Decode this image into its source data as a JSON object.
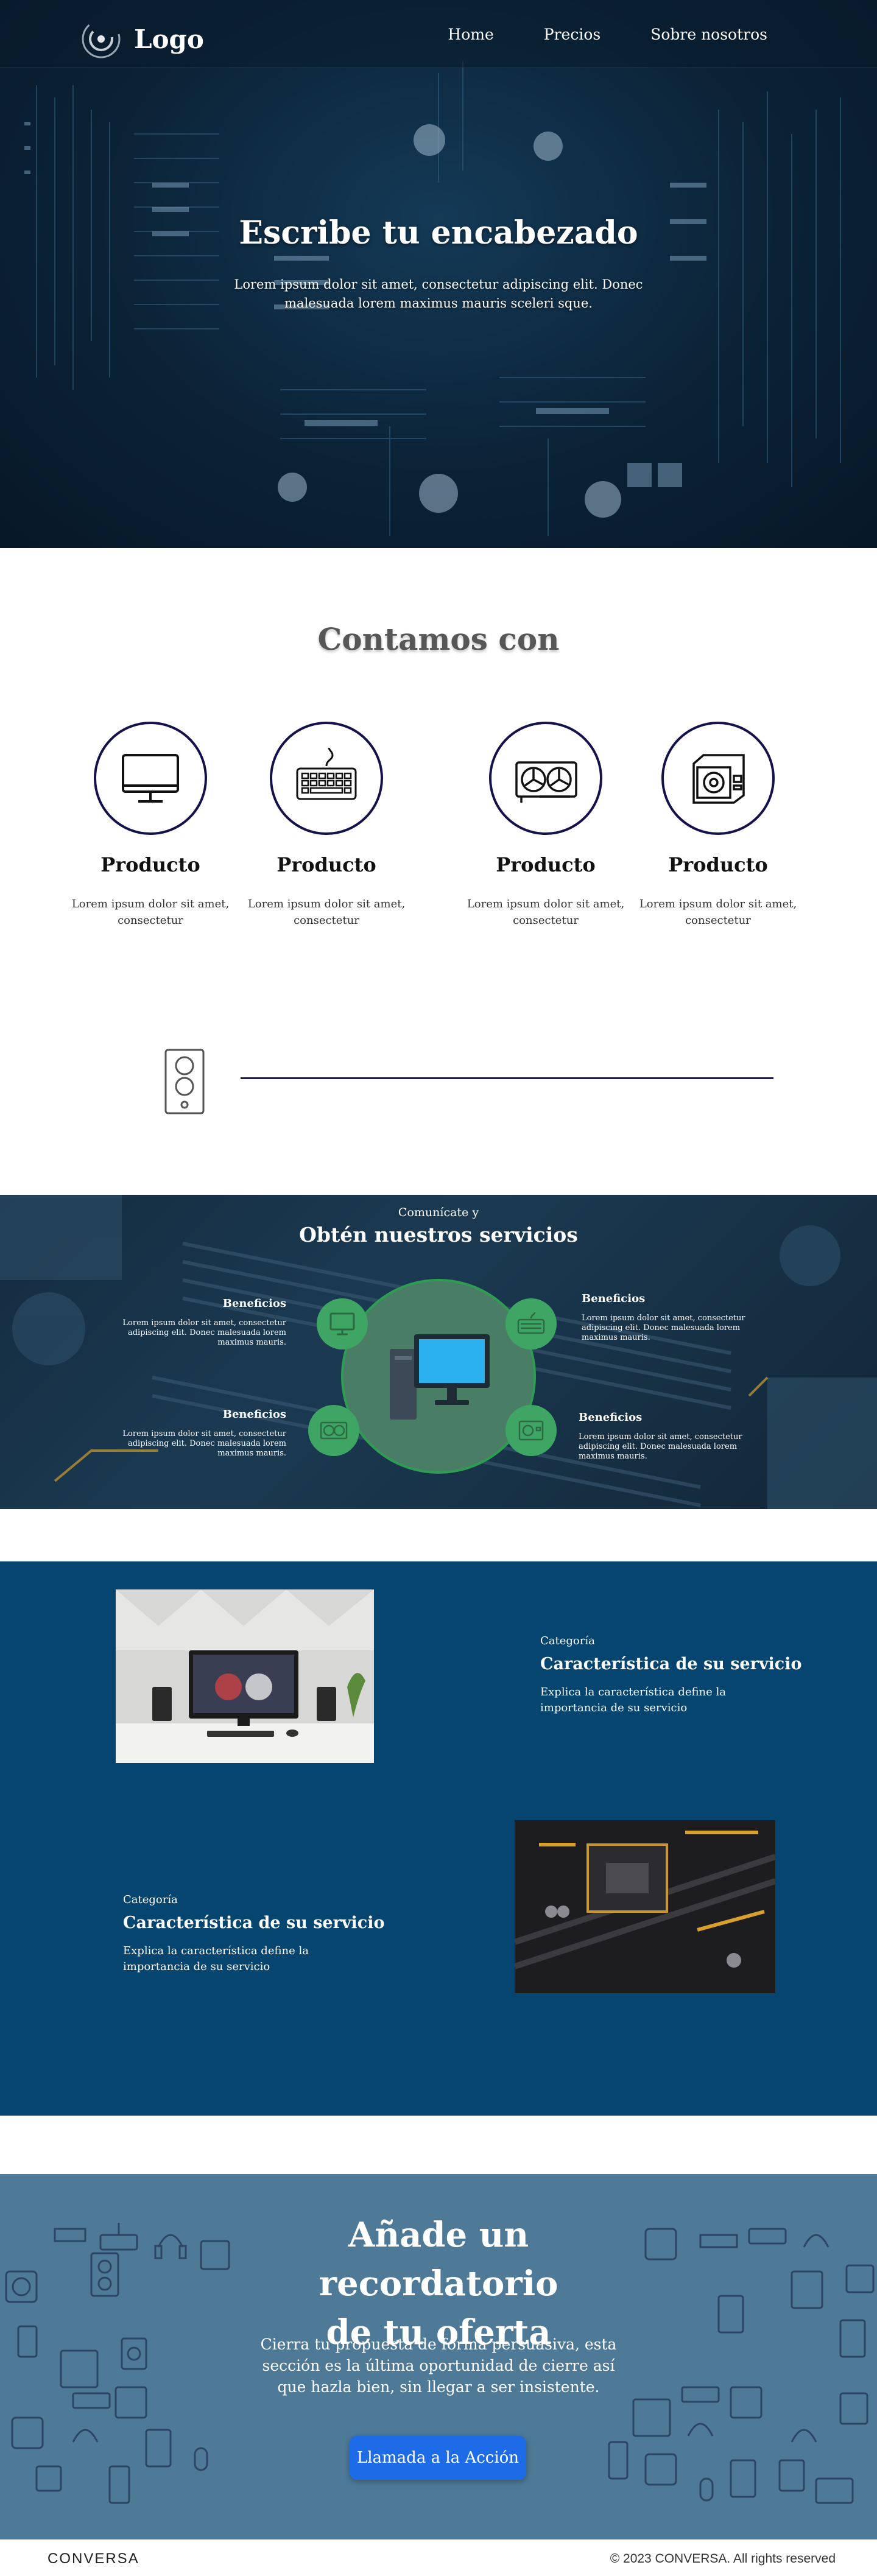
{
  "header": {
    "logo_text": "Logo",
    "nav": [
      "Home",
      "Precios",
      "Sobre nosotros"
    ]
  },
  "hero": {
    "title": "Escribe tu encabezado",
    "subtitle": "Lorem ipsum dolor sit amet, consectetur adipiscing elit. Donec malesuada lorem maximus mauris sceleri sque."
  },
  "features": {
    "title": "Contamos con",
    "items": [
      {
        "icon": "monitor-icon",
        "name": "Producto",
        "desc": "Lorem ipsum dolor sit amet, consectetur"
      },
      {
        "icon": "keyboard-icon",
        "name": "Producto",
        "desc": "Lorem ipsum dolor sit amet, consectetur"
      },
      {
        "icon": "graphics-card-icon",
        "name": "Producto",
        "desc": "Lorem ipsum dolor sit amet, consectetur"
      },
      {
        "icon": "power-supply-icon",
        "name": "Producto",
        "desc": "Lorem ipsum dolor sit amet, consectetur"
      }
    ],
    "divider_icon": "pc-tower-icon"
  },
  "services": {
    "pretitle": "Comunícate y",
    "title": "Obtén nuestros servicios",
    "benefits": [
      {
        "title": "Beneficios",
        "desc": "Lorem ipsum dolor sit amet, consectetur adipiscing elit. Donec malesuada lorem maximus mauris."
      },
      {
        "title": "Beneficios",
        "desc": "Lorem ipsum dolor sit amet, consectetur adipiscing elit. Donec malesuada lorem maximus mauris."
      },
      {
        "title": "Beneficios",
        "desc": "Lorem ipsum dolor sit amet, consectetur adipiscing elit. Donec malesuada lorem maximus mauris."
      },
      {
        "title": "Beneficios",
        "desc": "Lorem ipsum dolor sit amet, consectetur adipiscing elit. Donec malesuada lorem maximus mauris."
      }
    ]
  },
  "categories": [
    {
      "label": "Categoría",
      "title": "Característica de su servicio",
      "desc": "Explica la característica define la importancia de su servicio"
    },
    {
      "label": "Categoría",
      "title": "Característica de su servicio",
      "desc": "Explica la característica define la importancia de su servicio"
    }
  ],
  "cta": {
    "title_line1": "Añade un recordatorio",
    "title_line2": "de tu oferta",
    "text": "Cierra tu propuesta de forma persuasiva, esta sección es la última oportunidad de cierre así que hazla bien, sin llegar a ser insistente.",
    "button": "Llamada a la Acción"
  },
  "footer": {
    "brand": "CONVERSA",
    "copyright": "© 2023 CONVERSA. All rights reserved"
  },
  "colors": {
    "hero_bg": "#0b2236",
    "features_title": "#575757",
    "circle_border": "#14124a",
    "services_green": "#3ea564",
    "categories_bg": "#054570",
    "cta_bg": "#4e7a98",
    "cta_button": "#1e6be8"
  }
}
